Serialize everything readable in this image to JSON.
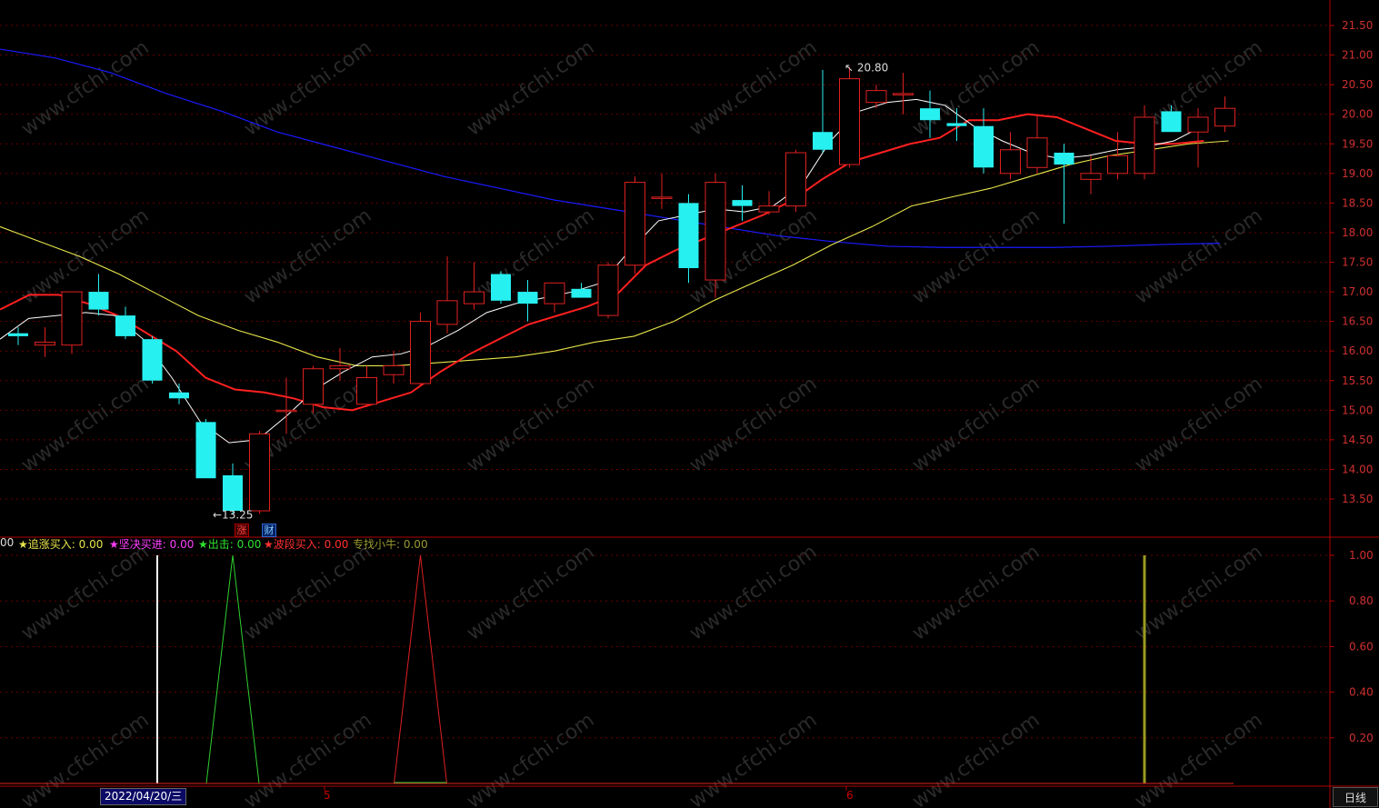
{
  "colors": {
    "up": "#e02020",
    "down": "#27f0f0",
    "ma5": "#ffffff",
    "ma10": "#ff2020",
    "ma20": "#e8e64a",
    "ma60": "#1a1aff",
    "grid": "#6a0000",
    "axis": "#b00000"
  },
  "price_axis": {
    "ticks": [
      "21.50",
      "21.00",
      "20.50",
      "20.00",
      "19.50",
      "19.00",
      "18.50",
      "18.00",
      "17.50",
      "17.00",
      "16.50",
      "16.00",
      "15.50",
      "15.00",
      "14.50",
      "14.00",
      "13.50"
    ]
  },
  "annotations": {
    "high_label": "20.80",
    "low_label": "13.25",
    "high_arrow": "↖",
    "low_arrow": "←"
  },
  "badges": {
    "zhang": "涨",
    "cai": "财"
  },
  "indicator": {
    "labels": [
      {
        "text": "00",
        "color": "#dddddd"
      },
      {
        "text": "★追涨买入: 0.00",
        "color": "#e8e64a"
      },
      {
        "text": "★坚决买进: 0.00",
        "color": "#ff40ff"
      },
      {
        "text": "★出击: 0.00",
        "color": "#30e030"
      },
      {
        "text": "★波段买入: 0.00",
        "color": "#ff3030"
      },
      {
        "text": "专找小牛: 0.00",
        "color": "#9a9a30"
      }
    ],
    "axis_ticks": [
      "1.00",
      "0.80",
      "0.60",
      "0.40",
      "0.20"
    ]
  },
  "time_axis": {
    "cursor_date": "2022/04/20/三",
    "month_labels": [
      "5",
      "6"
    ]
  },
  "period_button": "日线",
  "chart_data": {
    "type": "candlestick",
    "ylim": [
      13.0,
      21.8
    ],
    "candles": [
      {
        "o": 16.3,
        "h": 16.4,
        "l": 16.1,
        "c": 16.25
      },
      {
        "o": 16.1,
        "h": 16.4,
        "l": 15.9,
        "c": 16.15
      },
      {
        "o": 16.1,
        "h": 17.0,
        "l": 15.95,
        "c": 17.0
      },
      {
        "o": 17.0,
        "h": 17.3,
        "l": 16.6,
        "c": 16.7
      },
      {
        "o": 16.6,
        "h": 16.75,
        "l": 16.2,
        "c": 16.25
      },
      {
        "o": 16.2,
        "h": 16.25,
        "l": 15.45,
        "c": 15.5
      },
      {
        "o": 15.3,
        "h": 15.45,
        "l": 15.1,
        "c": 15.2
      },
      {
        "o": 14.8,
        "h": 14.85,
        "l": 13.85,
        "c": 13.85
      },
      {
        "o": 13.9,
        "h": 14.1,
        "l": 13.25,
        "c": 13.3
      },
      {
        "o": 13.3,
        "h": 14.65,
        "l": 13.25,
        "c": 14.6
      },
      {
        "o": 15.0,
        "h": 15.55,
        "l": 14.6,
        "c": 15.0
      },
      {
        "o": 15.1,
        "h": 15.75,
        "l": 14.95,
        "c": 15.7
      },
      {
        "o": 15.7,
        "h": 16.05,
        "l": 15.5,
        "c": 15.75
      },
      {
        "o": 15.1,
        "h": 15.75,
        "l": 15.05,
        "c": 15.55
      },
      {
        "o": 15.6,
        "h": 16.0,
        "l": 15.45,
        "c": 15.75
      },
      {
        "o": 15.45,
        "h": 16.65,
        "l": 15.4,
        "c": 16.5
      },
      {
        "o": 16.45,
        "h": 17.6,
        "l": 16.3,
        "c": 16.85
      },
      {
        "o": 16.8,
        "h": 17.5,
        "l": 16.7,
        "c": 17.0
      },
      {
        "o": 17.3,
        "h": 17.35,
        "l": 16.8,
        "c": 16.85
      },
      {
        "o": 17.0,
        "h": 17.2,
        "l": 16.5,
        "c": 16.8
      },
      {
        "o": 16.8,
        "h": 17.15,
        "l": 16.65,
        "c": 17.15
      },
      {
        "o": 17.05,
        "h": 17.15,
        "l": 16.9,
        "c": 16.9
      },
      {
        "o": 16.6,
        "h": 17.5,
        "l": 16.55,
        "c": 17.45
      },
      {
        "o": 17.45,
        "h": 18.95,
        "l": 17.3,
        "c": 18.85
      },
      {
        "o": 18.6,
        "h": 19.0,
        "l": 18.4,
        "c": 18.6
      },
      {
        "o": 18.5,
        "h": 18.65,
        "l": 17.15,
        "c": 17.4
      },
      {
        "o": 17.2,
        "h": 19.0,
        "l": 16.9,
        "c": 18.85
      },
      {
        "o": 18.55,
        "h": 18.8,
        "l": 18.2,
        "c": 18.45
      },
      {
        "o": 18.35,
        "h": 18.7,
        "l": 18.3,
        "c": 18.45
      },
      {
        "o": 18.45,
        "h": 19.4,
        "l": 18.35,
        "c": 19.35
      },
      {
        "o": 19.7,
        "h": 20.75,
        "l": 19.35,
        "c": 19.4
      },
      {
        "o": 19.15,
        "h": 20.8,
        "l": 19.1,
        "c": 20.6
      },
      {
        "o": 20.2,
        "h": 20.5,
        "l": 20.1,
        "c": 20.4
      },
      {
        "o": 20.35,
        "h": 20.7,
        "l": 20.0,
        "c": 20.35
      },
      {
        "o": 20.1,
        "h": 20.4,
        "l": 19.6,
        "c": 19.9
      },
      {
        "o": 19.85,
        "h": 20.1,
        "l": 19.55,
        "c": 19.8
      },
      {
        "o": 19.8,
        "h": 20.1,
        "l": 19.0,
        "c": 19.1
      },
      {
        "o": 19.0,
        "h": 19.7,
        "l": 18.9,
        "c": 19.4
      },
      {
        "o": 19.1,
        "h": 20.0,
        "l": 19.0,
        "c": 19.6
      },
      {
        "o": 19.35,
        "h": 19.5,
        "l": 18.15,
        "c": 19.15
      },
      {
        "o": 18.9,
        "h": 19.3,
        "l": 18.65,
        "c": 19.0
      },
      {
        "o": 19.0,
        "h": 19.7,
        "l": 18.9,
        "c": 19.3
      },
      {
        "o": 19.0,
        "h": 20.15,
        "l": 18.9,
        "c": 19.95
      },
      {
        "o": 20.05,
        "h": 20.15,
        "l": 19.7,
        "c": 19.7
      },
      {
        "o": 19.7,
        "h": 20.1,
        "l": 19.1,
        "c": 19.95
      },
      {
        "o": 19.8,
        "h": 20.3,
        "l": 19.7,
        "c": 20.1
      }
    ],
    "ma5": [
      16.2,
      16.55,
      16.6,
      16.65,
      16.6,
      16.2,
      15.55,
      14.8,
      14.45,
      14.5,
      14.9,
      15.35,
      15.65,
      15.9,
      15.95,
      16.1,
      16.35,
      16.65,
      16.8,
      16.9,
      17.0,
      17.15,
      17.7,
      18.2,
      18.3,
      18.4,
      18.35,
      18.45,
      18.8,
      19.55,
      20.05,
      20.2,
      20.25,
      20.15,
      19.8,
      19.55,
      19.35,
      19.25,
      19.3,
      19.4,
      19.45,
      19.55,
      19.8
    ],
    "ma10": [
      16.7,
      16.95,
      16.95,
      16.8,
      16.6,
      16.3,
      16.0,
      15.55,
      15.35,
      15.3,
      15.2,
      15.05,
      15.0,
      15.15,
      15.3,
      15.65,
      15.95,
      16.2,
      16.45,
      16.6,
      16.75,
      16.95,
      17.45,
      17.7,
      17.9,
      18.1,
      18.3,
      18.55,
      18.9,
      19.2,
      19.35,
      19.5,
      19.6,
      19.9,
      19.9,
      20.0,
      19.95,
      19.75,
      19.55,
      19.5,
      19.5,
      19.55
    ],
    "ma20": [
      18.1,
      17.85,
      17.6,
      17.3,
      16.95,
      16.6,
      16.35,
      16.15,
      15.9,
      15.75,
      15.75,
      15.8,
      15.85,
      15.9,
      16.0,
      16.15,
      16.25,
      16.5,
      16.85,
      17.15,
      17.45,
      17.8,
      18.1,
      18.45,
      18.6,
      18.75,
      18.95,
      19.15,
      19.3,
      19.4,
      19.5,
      19.55
    ],
    "ma60": [
      21.1,
      20.95,
      20.7,
      20.35,
      20.05,
      19.7,
      19.45,
      19.2,
      18.95,
      18.75,
      18.55,
      18.4,
      18.25,
      18.1,
      17.95,
      17.85,
      17.77,
      17.75,
      17.75,
      17.75,
      17.77,
      17.8,
      17.82
    ],
    "signals": {
      "green_peak_candle": 8,
      "red_peak_candle": 15,
      "olive_bar_candle": 42,
      "cursor_candle": 5
    }
  }
}
